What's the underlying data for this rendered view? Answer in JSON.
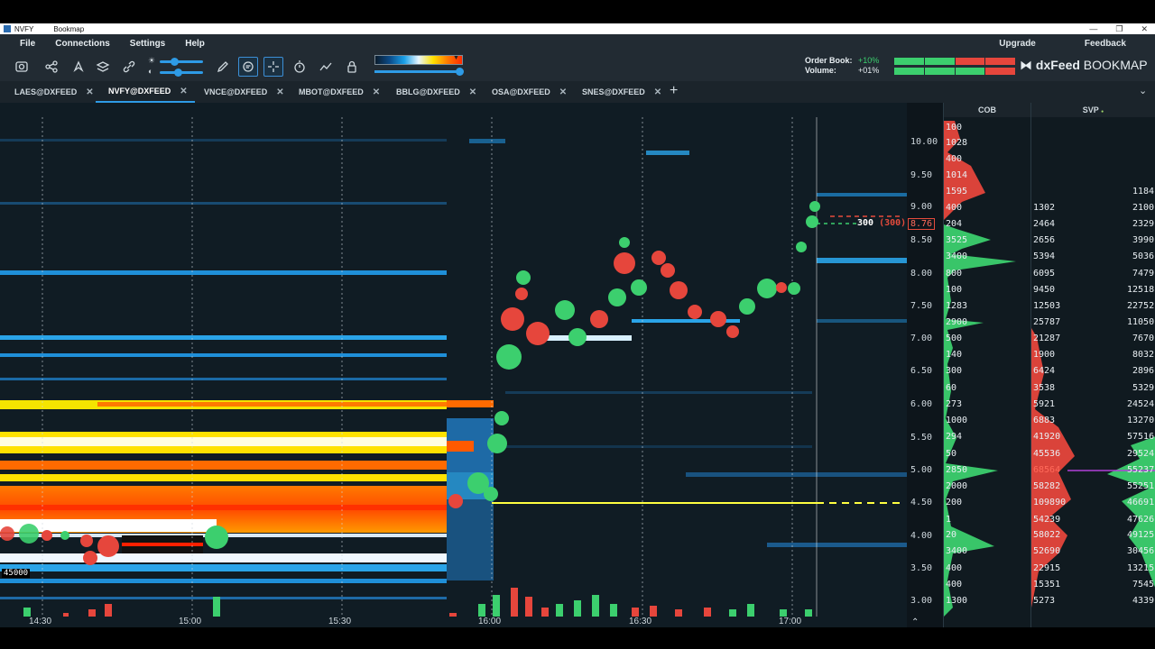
{
  "window": {
    "title": "NVFY",
    "app": "Bookmap"
  },
  "menu": {
    "items": [
      "File",
      "Connections",
      "Settings",
      "Help"
    ],
    "upgrade": "Upgrade",
    "feedback": "Feedback"
  },
  "toolbar": {
    "order_book_label": "Order Book:",
    "volume_label": "Volume:",
    "order_book_value": "+10%",
    "volume_value": "+01%",
    "brand_prefix": "dxFeed",
    "brand_name": "BOOKMAP"
  },
  "tabs": [
    {
      "label": "LAES@DXFEED",
      "active": false
    },
    {
      "label": "NVFY@DXFEED",
      "active": true
    },
    {
      "label": "VNCE@DXFEED",
      "active": false
    },
    {
      "label": "MBOT@DXFEED",
      "active": false
    },
    {
      "label": "BBLG@DXFEED",
      "active": false
    },
    {
      "label": "OSA@DXFEED",
      "active": false
    },
    {
      "label": "SNES@DXFEED",
      "active": false
    }
  ],
  "chart": {
    "price_labels": [
      "10.00",
      "9.50",
      "9.00",
      "8.76",
      "8.50",
      "8.00",
      "7.50",
      "7.00",
      "6.50",
      "6.00",
      "5.50",
      "5.00",
      "4.50",
      "4.00",
      "3.50",
      "3.00"
    ],
    "current_price": "8.76",
    "order_marker": "300",
    "order_marker_paren": "(300)",
    "time_labels": [
      "14:30",
      "15:00",
      "15:30",
      "16:00",
      "16:30",
      "17:00"
    ],
    "volume_scale": "45000"
  },
  "cob": {
    "header": "COB",
    "values": [
      "100",
      "1028",
      "400",
      "1014",
      "1595",
      "400",
      "204",
      "3525",
      "3400",
      "800",
      "100",
      "1283",
      "2900",
      "500",
      "140",
      "300",
      "60",
      "273",
      "1000",
      "294",
      "50",
      "2850",
      "2000",
      "200",
      "1",
      "20",
      "3400",
      "400",
      "400",
      "1300"
    ]
  },
  "svp": {
    "header": "SVP",
    "left": [
      "1302",
      "2464",
      "2656",
      "5394",
      "6095",
      "9450",
      "12503",
      "25787",
      "21287",
      "1900",
      "6424",
      "3538",
      "5921",
      "6883",
      "41920",
      "45536",
      "68564",
      "58282",
      "109890",
      "54239",
      "58022",
      "52690",
      "22915",
      "15351",
      "5273"
    ],
    "right": [
      "1184",
      "2100",
      "2329",
      "3990",
      "5036",
      "7479",
      "12518",
      "22752",
      "11050",
      "7670",
      "8032",
      "2896",
      "5329",
      "24524",
      "13270",
      "57516",
      "29524",
      "55237",
      "55251",
      "46691",
      "47626",
      "49125",
      "30456",
      "13215",
      "7545",
      "4339"
    ]
  },
  "colors": {
    "buy": "#3ccf6e",
    "sell": "#e6463c",
    "accent": "#2e9be6",
    "background": "#101c24"
  }
}
